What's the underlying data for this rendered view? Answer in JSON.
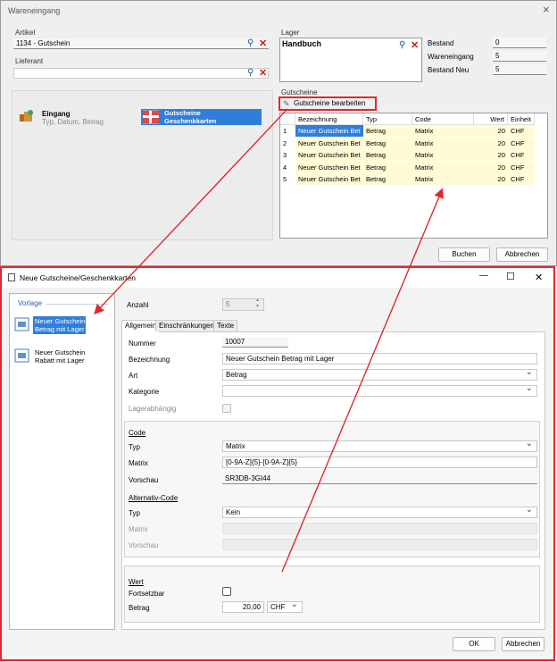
{
  "main": {
    "title": "Wareneingang",
    "close": "×",
    "artikel_label": "Artikel",
    "artikel_value": "1134 - Gutschein",
    "lieferant_label": "Lieferant",
    "lieferant_value": "",
    "lager_label": "Lager",
    "lager_value": "Handbuch",
    "bestand": [
      {
        "label": "Bestand",
        "value": "0"
      },
      {
        "label": "Wareneingang",
        "value": "5"
      },
      {
        "label": "Bestand Neu",
        "value": "5"
      }
    ],
    "eingang_title": "Eingang",
    "eingang_sub": "Typ, Datum, Betrag",
    "gutscheine_tile": "Gutscheine\nGeschenkkarten",
    "gutscheine_label": "Gutscheine",
    "edit_button": "Gutscheine bearbeiten",
    "table": {
      "headers": [
        "",
        "Bezeichnung",
        "Typ",
        "Code",
        "Wert",
        "Einheit"
      ],
      "rows": [
        [
          "1",
          "Neuer Gutschein Bet",
          "Betrag",
          "Matrix",
          "20",
          "CHF"
        ],
        [
          "2",
          "Neuer Gutschein Bet",
          "Betrag",
          "Matrix",
          "20",
          "CHF"
        ],
        [
          "3",
          "Neuer Gutschein Bet",
          "Betrag",
          "Matrix",
          "20",
          "CHF"
        ],
        [
          "4",
          "Neuer Gutschein Bet",
          "Betrag",
          "Matrix",
          "20",
          "CHF"
        ],
        [
          "5",
          "Neuer Gutschein Bet",
          "Betrag",
          "Matrix",
          "20",
          "CHF"
        ]
      ]
    },
    "buchen": "Buchen",
    "abbrechen": "Abbrechen"
  },
  "dialog": {
    "title": "Neue Gutscheine/Geschenkkarten",
    "min": "—",
    "max": "☐",
    "close": "✕",
    "vorlage_label": "Vorlage",
    "vorlagen": [
      {
        "line1": "Neuer Gutschein",
        "line2": "Betrag mit Lager"
      },
      {
        "line1": "Neuer Gutschein",
        "line2": "Rabatt mit Lager"
      }
    ],
    "anzahl_label": "Anzahl",
    "anzahl_value": "5",
    "tabs": [
      "Allgemein",
      "Einschränkungen",
      "Texte"
    ],
    "nummer_label": "Nummer",
    "nummer_value": "10007",
    "bezeichnung_label": "Bezeichnung",
    "bezeichnung_value": "Neuer Gutschein Betrag mit Lager",
    "art_label": "Art",
    "art_value": "Betrag",
    "kategorie_label": "Kategorie",
    "kategorie_value": "",
    "lagerabhaengig_label": "Lagerabhängig",
    "code_header": "Code",
    "code_typ_label": "Typ",
    "code_typ_value": "Matrix",
    "matrix_label": "Matrix",
    "matrix_value": "[0-9A-Z]{5}-[0-9A-Z]{5}",
    "vorschau_label": "Vorschau",
    "vorschau_value": "SR3DB-3GI44",
    "alt_header": "Alternativ-Code",
    "alt_typ_label": "Typ",
    "alt_typ_value": "Kein",
    "alt_matrix_label": "Matrix",
    "alt_vorschau_label": "Vorschau",
    "wert_header": "Wert",
    "fortsetzbar_label": "Fortsetzbar",
    "betrag_label": "Betrag",
    "betrag_value": "20,00",
    "currency": "CHF",
    "ok": "OK",
    "abbrechen": "Abbrechen"
  },
  "colors": {
    "highlight": "#e0282f",
    "selection": "#2f7fd8",
    "row_bg": "#fffbd6"
  }
}
